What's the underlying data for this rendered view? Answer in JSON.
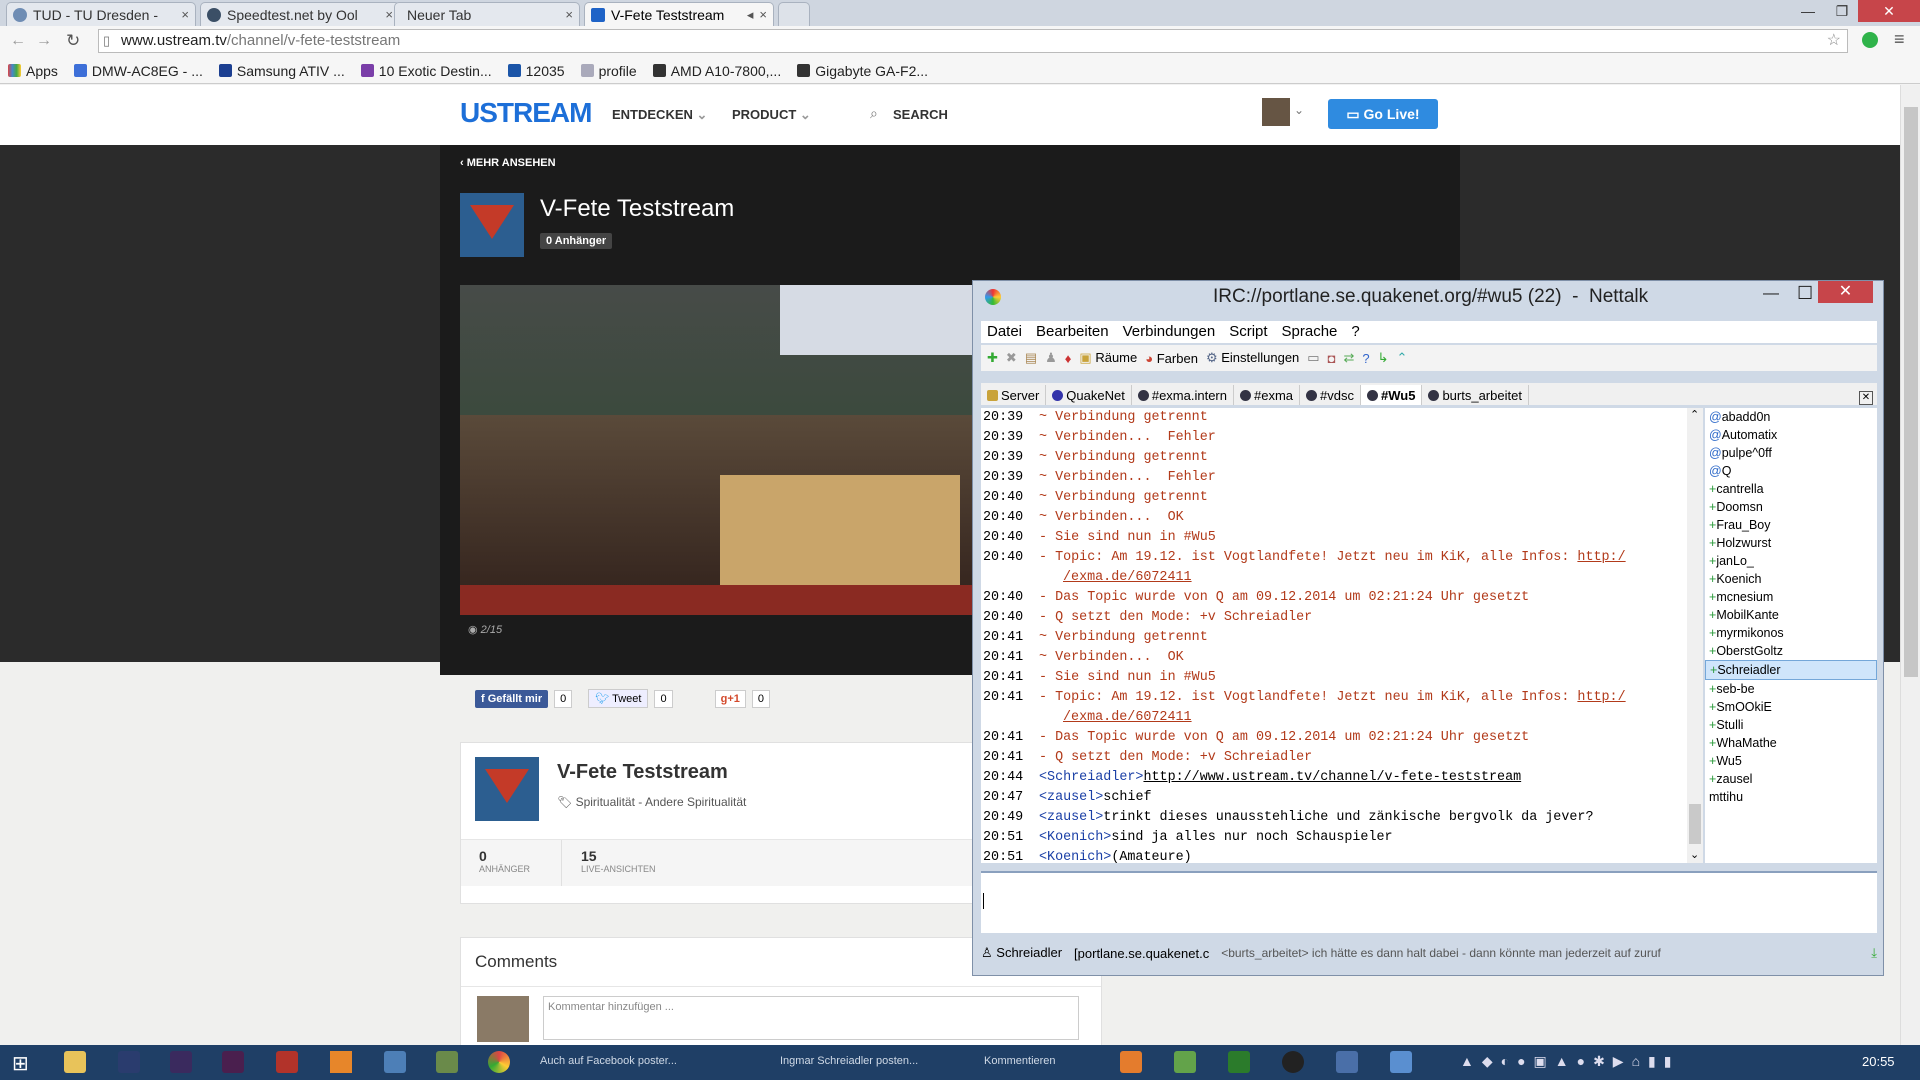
{
  "browser": {
    "tabs": [
      {
        "label": "TUD - TU Dresden -",
        "close": "×",
        "active": false
      },
      {
        "label": "Speedtest.net by Ool",
        "close": "×",
        "active": false
      },
      {
        "label": "Neuer Tab",
        "close": "×",
        "active": false
      },
      {
        "label": "V-Fete Teststream",
        "close": "×",
        "active": true
      }
    ],
    "url_domain": "www.ustream.tv",
    "url_path": "/channel/v-fete-teststream",
    "bookmarks": [
      "Apps",
      "DMW-AC8EG - ...",
      "Samsung ATIV ...",
      "10 Exotic Destin...",
      "12035",
      "profile",
      "AMD A10-7800,...",
      "Gigabyte GA-F2..."
    ]
  },
  "ustream": {
    "logo": "USTREAM",
    "nav": [
      "ENTDECKEN",
      "PRODUCT"
    ],
    "search": "SEARCH",
    "golive": "Go Live!",
    "back_link": "MEHR ANSEHEN",
    "channel_title": "V-Fete Teststream",
    "followers_badge": "0 Anhänger",
    "viewer_count": "2/15",
    "social": {
      "fb": "Gefällt mir",
      "fb_count": "0",
      "tw": "Tweet",
      "tw_count": "0",
      "gp": "+1",
      "gp_count": "0"
    },
    "info_title": "V-Fete Teststream",
    "category": "Spiritualität - Andere Spiritualität",
    "stats": [
      {
        "value": "0",
        "label": "ANHÄNGER"
      },
      {
        "value": "15",
        "label": "LIVE-ANSICHTEN"
      }
    ],
    "comments_title": "Comments",
    "comment_placeholder": "Kommentar hinzufügen ..."
  },
  "irc": {
    "title": "IRC://portlane.se.quakenet.org/#wu5 (22)  -  Nettalk",
    "menu": [
      "Datei",
      "Bearbeiten",
      "Verbindungen",
      "Script",
      "Sprache",
      "?"
    ],
    "toolbar": [
      "Räume",
      "Farben",
      "Einstellungen"
    ],
    "tabs": [
      "Server",
      "QuakeNet",
      "#exma.intern",
      "#exma",
      "#vdsc",
      "#Wu5",
      "burts_arbeitet"
    ],
    "active_tab": "#Wu5",
    "log": [
      {
        "t": "20:39",
        "kind": "sys",
        "text": "~ Verbindung getrennt"
      },
      {
        "t": "20:39",
        "kind": "sys",
        "text": "~ Verbinden...  Fehler"
      },
      {
        "t": "20:39",
        "kind": "sys",
        "text": "~ Verbindung getrennt"
      },
      {
        "t": "20:39",
        "kind": "sys",
        "text": "~ Verbinden...  Fehler"
      },
      {
        "t": "20:40",
        "kind": "sys",
        "text": "~ Verbindung getrennt"
      },
      {
        "t": "20:40",
        "kind": "sys",
        "text": "~ Verbinden...  OK"
      },
      {
        "t": "20:40",
        "kind": "sys",
        "text": "- Sie sind nun in #Wu5"
      },
      {
        "t": "20:40",
        "kind": "topic",
        "text": "- Topic: Am 19.12. ist Vogtlandfete! Jetzt neu im KiK, alle Infos: ",
        "link": "http:/",
        "cont": "/exma.de/6072411"
      },
      {
        "t": "20:40",
        "kind": "sys",
        "text": "- Das Topic wurde von Q am 09.12.2014 um 02:21:24 Uhr gesetzt"
      },
      {
        "t": "20:40",
        "kind": "sys",
        "text": "- Q setzt den Mode: +v Schreiadler"
      },
      {
        "t": "20:41",
        "kind": "sys",
        "text": "~ Verbindung getrennt"
      },
      {
        "t": "20:41",
        "kind": "sys",
        "text": "~ Verbinden...  OK"
      },
      {
        "t": "20:41",
        "kind": "sys",
        "text": "- Sie sind nun in #Wu5"
      },
      {
        "t": "20:41",
        "kind": "topic",
        "text": "- Topic: Am 19.12. ist Vogtlandfete! Jetzt neu im KiK, alle Infos: ",
        "link": "http:/",
        "cont": "/exma.de/6072411"
      },
      {
        "t": "20:41",
        "kind": "sys",
        "text": "- Das Topic wurde von Q am 09.12.2014 um 02:21:24 Uhr gesetzt"
      },
      {
        "t": "20:41",
        "kind": "sys",
        "text": "- Q setzt den Mode: +v Schreiadler"
      },
      {
        "t": "20:44",
        "kind": "msg",
        "nick": "<Schreiadler>",
        "link": "http://www.ustream.tv/channel/v-fete-teststream"
      },
      {
        "t": "20:47",
        "kind": "msg",
        "nick": "<zausel>",
        "text": "schief"
      },
      {
        "t": "20:49",
        "kind": "msg",
        "nick": "<zausel>",
        "text": "trinkt dieses unausstehliche und zänkische bergvolk da jever?"
      },
      {
        "t": "20:51",
        "kind": "msg",
        "nick": "<Koenich>",
        "text": "sind ja alles nur noch Schauspieler"
      },
      {
        "t": "20:51",
        "kind": "msg",
        "nick": "<Koenich>",
        "text": "(Amateure)"
      }
    ],
    "users": [
      {
        "name": "abadd0n",
        "prefix": "@"
      },
      {
        "name": "Automatix",
        "prefix": "@"
      },
      {
        "name": "pulpe^0ff",
        "prefix": "@"
      },
      {
        "name": "Q",
        "prefix": "@"
      },
      {
        "name": "cantrella",
        "prefix": "+"
      },
      {
        "name": "Doomsn",
        "prefix": "+"
      },
      {
        "name": "Frau_Boy",
        "prefix": "+"
      },
      {
        "name": "Holzwurst",
        "prefix": "+"
      },
      {
        "name": "janLo_",
        "prefix": "+"
      },
      {
        "name": "Koenich",
        "prefix": "+"
      },
      {
        "name": "mcnesium",
        "prefix": "+"
      },
      {
        "name": "MobilKante",
        "prefix": "+"
      },
      {
        "name": "myrmikonos",
        "prefix": "+"
      },
      {
        "name": "OberstGoltz",
        "prefix": "+"
      },
      {
        "name": "Schreiadler",
        "prefix": "+",
        "selected": true
      },
      {
        "name": "seb-be",
        "prefix": "+"
      },
      {
        "name": "SmOOkiE",
        "prefix": "+"
      },
      {
        "name": "Stulli",
        "prefix": "+"
      },
      {
        "name": "WhaMathe",
        "prefix": "+"
      },
      {
        "name": "Wu5",
        "prefix": "+"
      },
      {
        "name": "zausel",
        "prefix": "+"
      },
      {
        "name": "mttihu",
        "prefix": ""
      }
    ],
    "status_nick": "Schreiadler",
    "status_server": "[portlane.se.quakenet.c",
    "status_msg": "<burts_arbeitet> ich hätte es dann halt dabei - dann könnte man jederzeit auf zuruf"
  },
  "taskbar": {
    "items": [
      "Auch auf Facebook poster...",
      "Ingmar Schreiadler posten...",
      "Kommentieren"
    ],
    "clock": "20:55"
  }
}
